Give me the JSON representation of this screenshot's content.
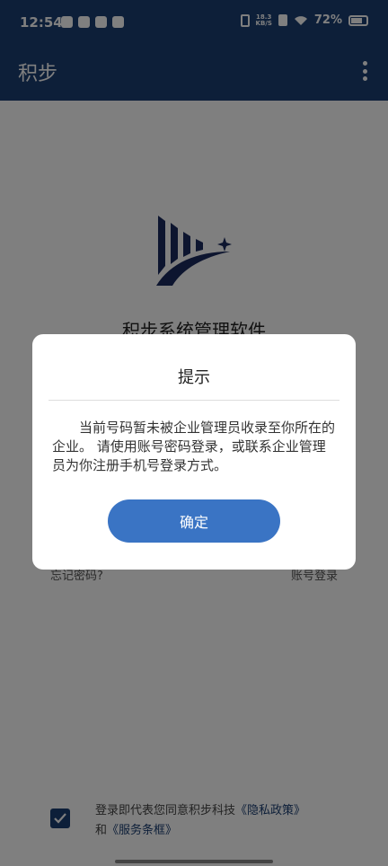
{
  "status_bar": {
    "time": "12:54",
    "net_speed_value": "18.3",
    "net_speed_unit": "KB/S",
    "battery": "72%"
  },
  "app_bar": {
    "title": "积步"
  },
  "main": {
    "app_name": "积步系统管理软件",
    "forgot_password": "忘记密码?",
    "account_login": "账号登录",
    "agreement_prefix": "登录即代表您同意积步科技",
    "privacy_link": "《隐私政策》",
    "agreement_and": "和",
    "terms_link": "《服务条框》"
  },
  "dialog": {
    "title": "提示",
    "message": "当前号码暂未被企业管理员收录至你所在的企业。 请使用账号密码登录，或联系企业管理员为你注册手机号登录方式。",
    "confirm": "确定"
  },
  "colors": {
    "brand": "#1b3e72",
    "button": "#3a74c4"
  }
}
